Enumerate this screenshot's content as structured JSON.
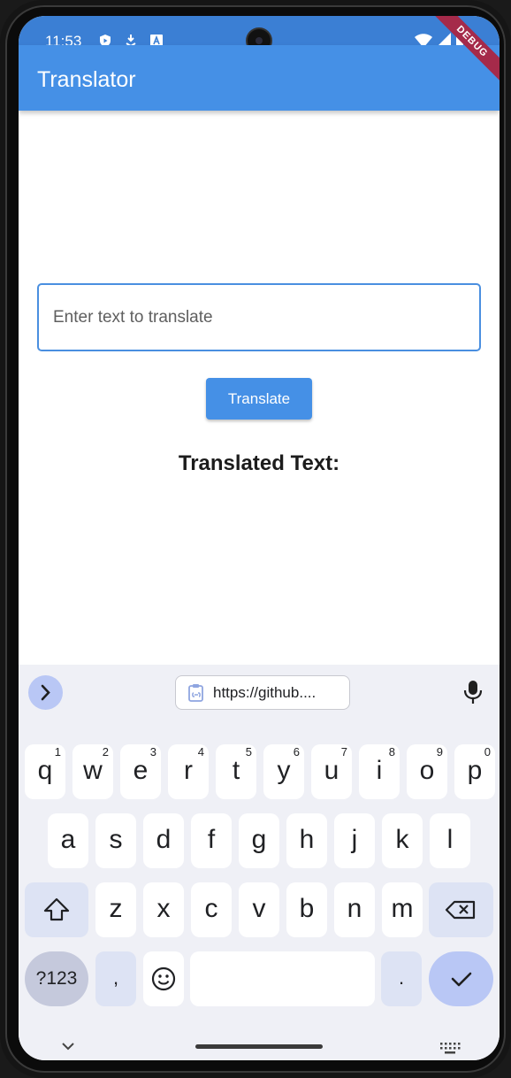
{
  "status_bar": {
    "time": "11:53",
    "left_icons": [
      "shield-icon",
      "download-icon",
      "a-box-icon"
    ],
    "right_icons": [
      "wifi-icon",
      "signal-icon",
      "battery-icon"
    ]
  },
  "debug_banner": "DEBUG",
  "app_bar": {
    "title": "Translator"
  },
  "form": {
    "input_placeholder": "Enter text to translate",
    "input_value": "",
    "translate_button": "Translate",
    "result_label": "Translated Text:"
  },
  "keyboard": {
    "clipboard_text": "https://github....",
    "row1": [
      {
        "key": "q",
        "hint": "1"
      },
      {
        "key": "w",
        "hint": "2"
      },
      {
        "key": "e",
        "hint": "3"
      },
      {
        "key": "r",
        "hint": "4"
      },
      {
        "key": "t",
        "hint": "5"
      },
      {
        "key": "y",
        "hint": "6"
      },
      {
        "key": "u",
        "hint": "7"
      },
      {
        "key": "i",
        "hint": "8"
      },
      {
        "key": "o",
        "hint": "9"
      },
      {
        "key": "p",
        "hint": "0"
      }
    ],
    "row2": [
      "a",
      "s",
      "d",
      "f",
      "g",
      "h",
      "j",
      "k",
      "l"
    ],
    "row3": [
      "z",
      "x",
      "c",
      "v",
      "b",
      "n",
      "m"
    ],
    "symbols_key": "?123",
    "comma_key": ",",
    "period_key": ".",
    "space_key": ""
  },
  "colors": {
    "app_bar": "#4590e6",
    "status_bar": "#3b7fd4",
    "accent": "#4590e6",
    "keyboard_bg": "#eff0f6"
  }
}
